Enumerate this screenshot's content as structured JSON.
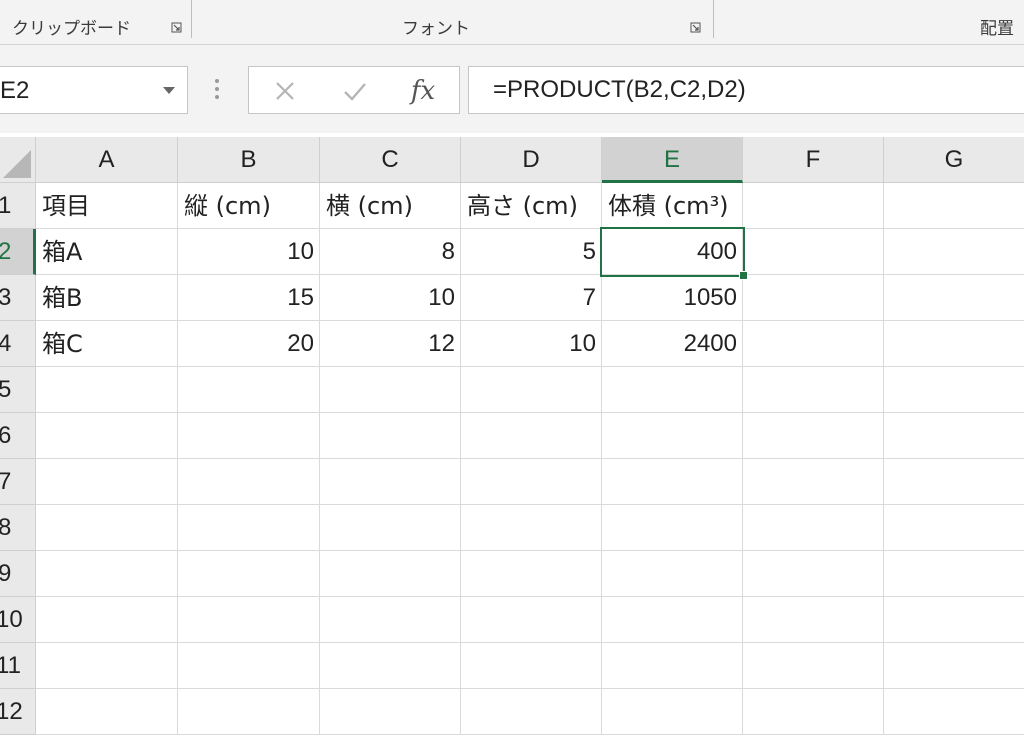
{
  "ribbon": {
    "clipboard_label": "クリップボード",
    "font_label": "フォント",
    "alignment_label": "配置"
  },
  "formula_bar": {
    "name_box_value": "E2",
    "cancel_icon": "x-icon",
    "enter_icon": "check-icon",
    "fx_label": "fx",
    "formula": "=PRODUCT(B2,C2,D2)"
  },
  "columns": [
    "A",
    "B",
    "C",
    "D",
    "E",
    "F",
    "G"
  ],
  "rows": [
    "1",
    "2",
    "3",
    "4",
    "5",
    "6",
    "7",
    "8",
    "9",
    "10",
    "11",
    "12"
  ],
  "cells": {
    "A1": "項目",
    "B1": "縦 (cm)",
    "C1": "横 (cm)",
    "D1": "高さ (cm)",
    "E1": "体積 (cm³)",
    "A2": "箱A",
    "B2": "10",
    "C2": "8",
    "D2": "5",
    "E2": "400",
    "A3": "箱B",
    "B3": "15",
    "C3": "10",
    "D3": "7",
    "E3": "1050",
    "A4": "箱C",
    "B4": "20",
    "C4": "12",
    "D4": "10",
    "E4": "2400"
  },
  "selected_cell": "E2",
  "colors": {
    "accent": "#217346",
    "header_bg": "#e9e9e9",
    "header_selected_bg": "#d2d2d2"
  }
}
